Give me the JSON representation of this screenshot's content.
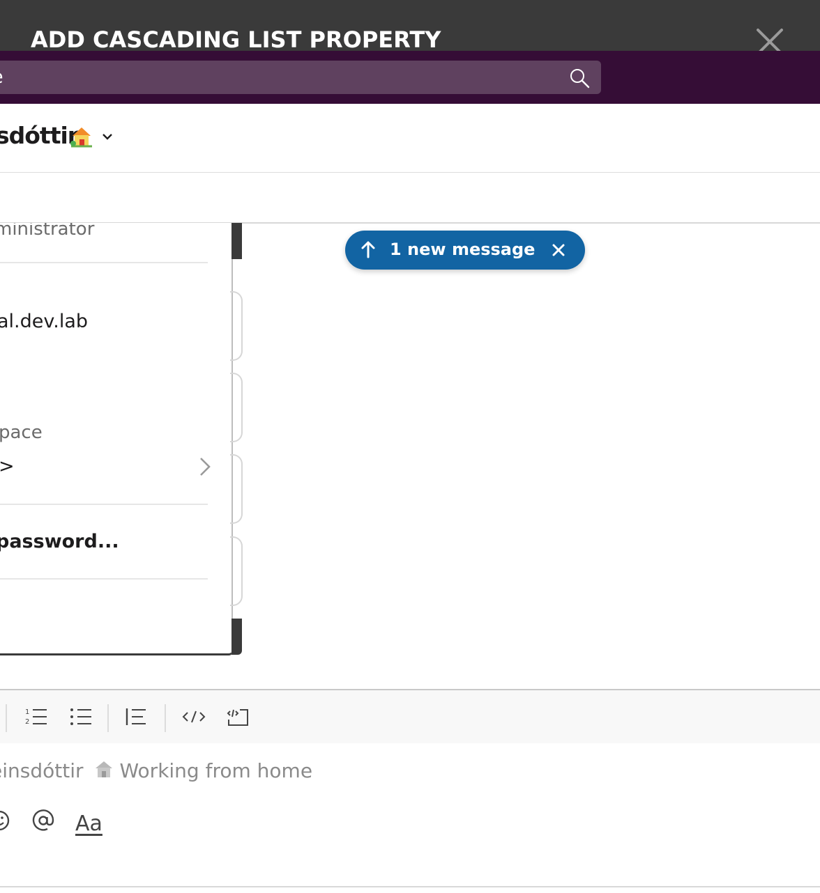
{
  "modal": {
    "title": "ADD CASCADING LIST PROPERTY"
  },
  "topbar": {
    "search_text": "e"
  },
  "channel": {
    "name": "sdóttir"
  },
  "panel": {
    "role": "ministrator",
    "domain": "al.dev.lab",
    "section_label": "pace",
    "section_value": ">",
    "password_item": "password..."
  },
  "new_message": {
    "label": "1 new message"
  },
  "composer": {
    "placeholder_name": "einsdóttir",
    "placeholder_status": "Working from home",
    "format_label": "Aa"
  },
  "icons": {
    "close": "close-icon",
    "search": "search-icon",
    "house": "house-icon",
    "chevron": "chevron-down-icon",
    "arrow_up": "arrow-up-icon",
    "numbered_list": "numbered-list-icon",
    "bulleted_list": "bulleted-list-icon",
    "blockquote": "blockquote-icon",
    "code": "code-icon",
    "code_block": "code-block-icon",
    "emoji": "emoji-icon",
    "mention": "mention-icon"
  },
  "colors": {
    "modal_header": "#3a3a3a",
    "topbar": "#350d36",
    "search_box": "#5f415f",
    "new_message_pill": "#1264a3"
  }
}
